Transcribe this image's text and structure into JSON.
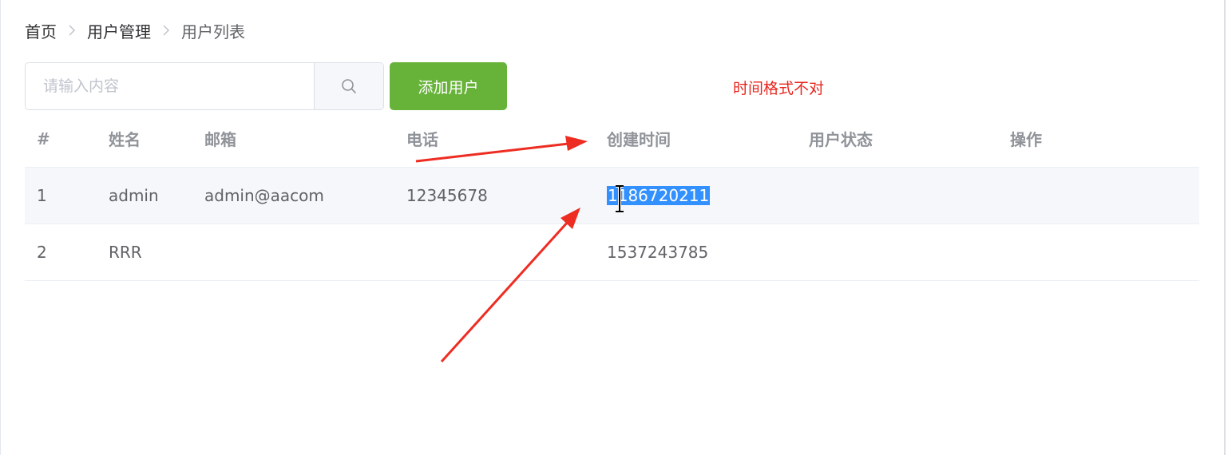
{
  "breadcrumb": [
    "首页",
    "用户管理",
    "用户列表"
  ],
  "search": {
    "placeholder": "请输入内容",
    "value": ""
  },
  "toolbar": {
    "add_user_label": "添加用户"
  },
  "annotation": {
    "text": "时间格式不对",
    "color": "#e8261f"
  },
  "table": {
    "columns": [
      "#",
      "姓名",
      "邮箱",
      "电话",
      "创建时间",
      "用户状态",
      "操作"
    ],
    "rows": [
      [
        "1",
        "admin",
        "admin@aacom",
        "12345678",
        "1186720211",
        "",
        ""
      ],
      [
        "2",
        "RRR",
        "",
        "",
        "1537243785",
        "",
        ""
      ]
    ]
  },
  "colors": {
    "primary_button": "#67b33a",
    "selection": "#3390ff",
    "arrow": "#ee2d22"
  }
}
